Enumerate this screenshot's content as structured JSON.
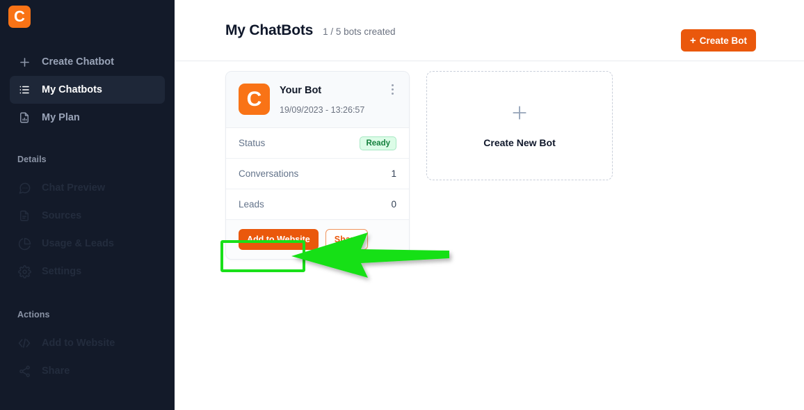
{
  "brand": {
    "logo_letter": "C",
    "logo_color": "#f97316"
  },
  "sidebar": {
    "nav": [
      {
        "label": "Create Chatbot",
        "icon": "plus-icon",
        "state": "default"
      },
      {
        "label": "My Chatbots",
        "icon": "list-icon",
        "state": "active"
      },
      {
        "label": "My Plan",
        "icon": "document-chart-icon",
        "state": "default"
      }
    ],
    "groups": [
      {
        "label": "Details",
        "items": [
          {
            "label": "Chat Preview",
            "icon": "chat-bubble-icon",
            "state": "disabled"
          },
          {
            "label": "Sources",
            "icon": "document-icon",
            "state": "disabled"
          },
          {
            "label": "Usage & Leads",
            "icon": "pie-chart-icon",
            "state": "disabled"
          },
          {
            "label": "Settings",
            "icon": "gear-icon",
            "state": "disabled"
          }
        ]
      },
      {
        "label": "Actions",
        "items": [
          {
            "label": "Add to Website",
            "icon": "code-icon",
            "state": "disabled"
          },
          {
            "label": "Share",
            "icon": "share-icon",
            "state": "disabled"
          }
        ]
      }
    ]
  },
  "header": {
    "title": "My ChatBots",
    "subtitle": "1 / 5 bots created",
    "create_button": {
      "plus": "+",
      "label": "Create Bot",
      "color": "#ea580c"
    }
  },
  "bot_card": {
    "avatar_letter": "C",
    "name": "Your Bot",
    "created_at": "19/09/2023 - 13:26:57",
    "menu_icon": "kebab-menu-icon",
    "stats": [
      {
        "label": "Status",
        "value": "Ready",
        "type": "badge",
        "badge_color": "#15803d"
      },
      {
        "label": "Conversations",
        "value": "1",
        "type": "text"
      },
      {
        "label": "Leads",
        "value": "0",
        "type": "text"
      }
    ],
    "actions": [
      {
        "label": "Add to Website",
        "style": "primary"
      },
      {
        "label": "Share",
        "style": "outline"
      }
    ]
  },
  "new_bot_card": {
    "icon": "plus-icon",
    "label": "Create New Bot"
  },
  "annotation": {
    "arrow_color": "#19e019",
    "highlight_color": "#19e019",
    "points_to": "Add to Website"
  }
}
